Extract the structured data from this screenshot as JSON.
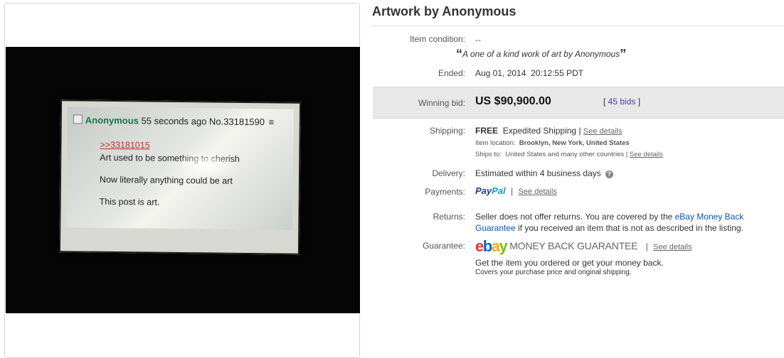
{
  "listing": {
    "title": "Artwork by Anonymous",
    "condition_label": "Item condition:",
    "condition_value": "--",
    "quote_open": "“",
    "quote_text": "A one of a kind work of art by Anonymous",
    "quote_close": "”",
    "ended_label": "Ended:",
    "ended_value": "Aug 01, 2014  20:12:55 PDT",
    "winning_bid_label": "Winning bid:",
    "winning_bid_value": "US $90,900.00",
    "bids_open": "[ ",
    "bids_link": "45 bids",
    "bids_close": " ]"
  },
  "shipping": {
    "label": "Shipping:",
    "free": "FREE",
    "method": "Expedited Shipping",
    "divider": "|",
    "see_details": "See details",
    "item_location_label": "Item location:",
    "item_location_value": "Brooklyn, New York, United States",
    "ships_to_label": "Ships to:",
    "ships_to_value": "United States and many other countries",
    "ships_divider": "|",
    "ships_see_details": "See details"
  },
  "delivery": {
    "label": "Delivery:",
    "value": "Estimated within 4 business days",
    "help_icon": "?"
  },
  "payments": {
    "label": "Payments:",
    "paypal_pay": "Pay",
    "paypal_pal": "Pal",
    "divider": "|",
    "see_details": "See details"
  },
  "returns": {
    "label": "Returns:",
    "line1_pre": "Seller does not offer returns. You are covered by the ",
    "line1_link": "eBay Money Back",
    "line2_link": "Guarantee",
    "line2_post": " if you received an item that is not as described in the listing."
  },
  "guarantee": {
    "label": "Guarantee:",
    "logo_e": "e",
    "logo_b": "b",
    "logo_a": "a",
    "logo_y": "y",
    "mbg_text": "MONEY BACK GUARANTEE",
    "divider": "|",
    "see_details": "See details",
    "line1": "Get the item you ordered or get your money back.",
    "line2": "Covers your purchase price and original shipping."
  },
  "photo_post": {
    "name": "Anonymous",
    "meta": "55 seconds ago No.33181590",
    "menu_icon": "≡",
    "reply_link": ">>33181015",
    "line1": "Art used to be something to cherish",
    "line2": "Now literally anything could be art",
    "line3": "This post is art."
  },
  "colors": {
    "paypal_dark": "#253b80",
    "paypal_light": "#179bd7",
    "ebay_red": "#e53238",
    "ebay_blue": "#0064d2",
    "ebay_yellow": "#f5af02",
    "ebay_green": "#86b817",
    "link_blue": "#0654ba",
    "bids_purple": "#5336a8",
    "post_name_green": "#117743"
  }
}
